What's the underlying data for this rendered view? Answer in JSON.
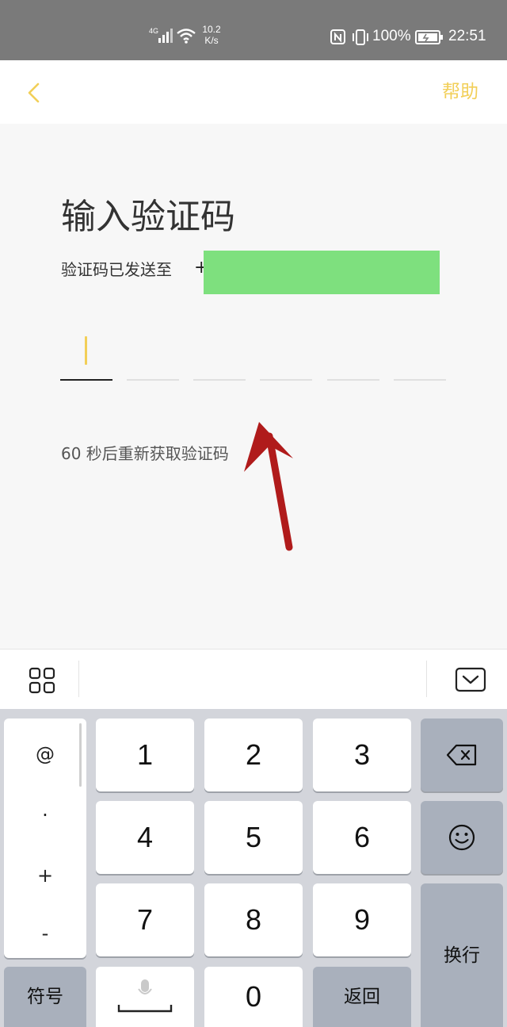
{
  "status_bar": {
    "network": "4G",
    "speed_value": "10.2",
    "speed_unit": "K/s",
    "battery": "100%",
    "time": "22:51",
    "icons": [
      "signal-icon",
      "wifi-icon",
      "nfc-icon",
      "vibrate-icon",
      "battery-icon"
    ]
  },
  "header": {
    "back_icon": "chevron-left-icon",
    "help_label": "帮助",
    "accent_color": "#f2cf58"
  },
  "main": {
    "title": "输入验证码",
    "subtitle": "验证码已发送至",
    "phone_prefix": "+",
    "code_length": 6,
    "resend_text": "60 秒后重新获取验证码"
  },
  "keyboard_toolbar": {
    "apps_icon": "grid-icon",
    "hide_icon": "keyboard-hide-icon"
  },
  "keyboard": {
    "symbols": [
      "@",
      ".",
      "+",
      "-"
    ],
    "keys": {
      "k1": "1",
      "k2": "2",
      "k3": "3",
      "k4": "4",
      "k5": "5",
      "k6": "6",
      "k7": "7",
      "k8": "8",
      "k9": "9",
      "k0": "0"
    },
    "symbol_key": "符号",
    "back_key": "返回",
    "enter_key": "换行",
    "backspace_icon": "backspace-icon",
    "emoji_icon": "smiley-icon",
    "mic_icon": "microphone-icon"
  }
}
